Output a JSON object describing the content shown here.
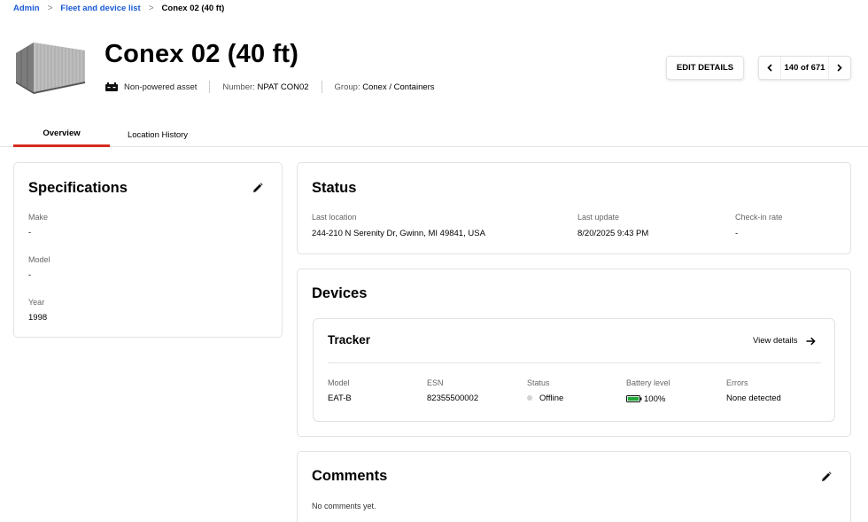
{
  "breadcrumb": {
    "items": [
      "Admin",
      "Fleet and device list"
    ],
    "current": "Conex 02 (40 ft)"
  },
  "header": {
    "title": "Conex 02 (40 ft)",
    "asset_type": "Non-powered asset",
    "number_label": "Number:",
    "number_value": "NPAT CON02",
    "group_label": "Group:",
    "group_value": "Conex / Containers",
    "edit_label": "EDIT DETAILS",
    "pager_text": "140 of 671"
  },
  "tabs": [
    {
      "label": "Overview",
      "active": true
    },
    {
      "label": "Location History",
      "active": false
    }
  ],
  "specifications": {
    "title": "Specifications",
    "fields": [
      {
        "label": "Make",
        "value": "-"
      },
      {
        "label": "Model",
        "value": "-"
      },
      {
        "label": "Year",
        "value": "1998"
      }
    ]
  },
  "status": {
    "title": "Status",
    "last_location_label": "Last location",
    "last_location_value": "244-210 N Serenity Dr, Gwinn, MI 49841, USA",
    "last_update_label": "Last update",
    "last_update_value": "8/20/2025 9:43 PM",
    "checkin_label": "Check-in rate",
    "checkin_value": "-"
  },
  "devices": {
    "title": "Devices",
    "tracker": {
      "title": "Tracker",
      "view_details": "View details",
      "columns": [
        "Model",
        "ESN",
        "Status",
        "Battery level",
        "Errors"
      ],
      "values": {
        "model": "EAT-B",
        "esn": "82355500002",
        "status": "Offline",
        "battery": "100%",
        "battery_level": 1.0,
        "errors": "None detected"
      }
    }
  },
  "comments": {
    "title": "Comments",
    "empty": "No comments yet."
  },
  "colors": {
    "link": "#1a5bd8",
    "tab_active": "#d52b1e",
    "battery": "#22a838",
    "offline_dot": "#d2d2d2"
  }
}
